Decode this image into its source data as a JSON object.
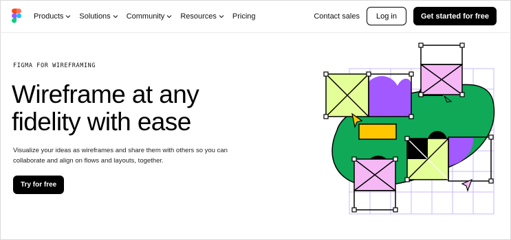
{
  "nav": {
    "logo": "figma-logo",
    "items": [
      {
        "label": "Products",
        "has_dropdown": true
      },
      {
        "label": "Solutions",
        "has_dropdown": true
      },
      {
        "label": "Community",
        "has_dropdown": true
      },
      {
        "label": "Resources",
        "has_dropdown": true
      },
      {
        "label": "Pricing",
        "has_dropdown": false
      }
    ],
    "contact_label": "Contact sales",
    "login_label": "Log in",
    "cta_label": "Get started for free"
  },
  "hero": {
    "eyebrow": "FIGMA FOR WIREFRAMING",
    "headline": "Wireframe at any fidelity with ease",
    "description": "Visualize your ideas as wireframes and share them with others so you can collaborate and align on flows and layouts, together.",
    "button_label": "Try for free"
  },
  "colors": {
    "green": "#0fa958",
    "purple": "#a259ff",
    "pink": "#f5b8f5",
    "lime": "#e4ff97",
    "yellow": "#ffc700",
    "grid": "#c7b8ff",
    "black": "#000000"
  }
}
